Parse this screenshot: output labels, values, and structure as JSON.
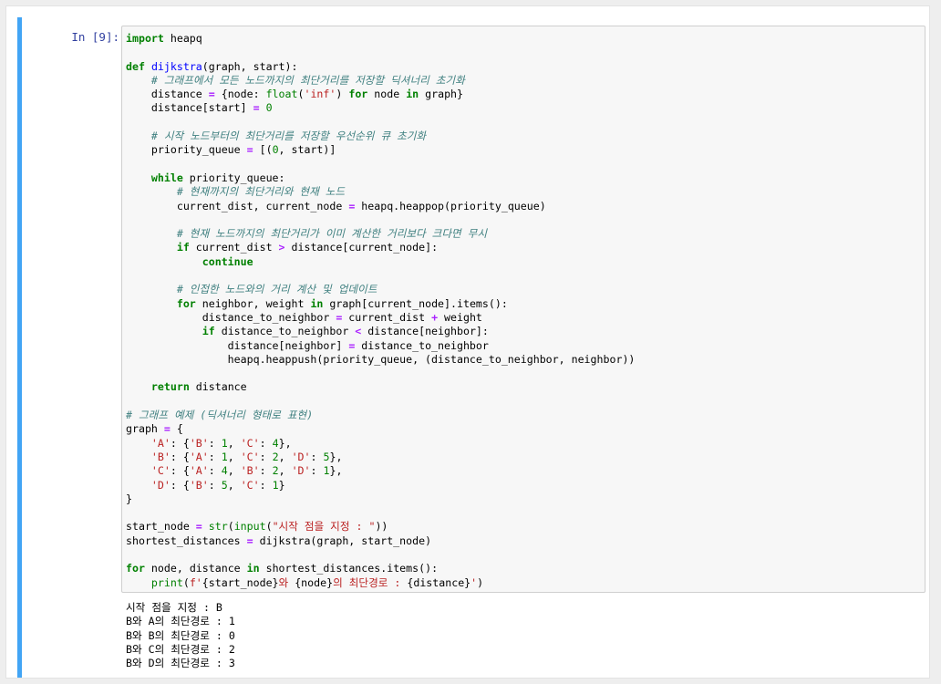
{
  "cell": {
    "prompt": "In [9]:",
    "code_lines": [
      [
        [
          "kw",
          "import"
        ],
        [
          "t",
          " heapq"
        ]
      ],
      [],
      [
        [
          "kw",
          "def"
        ],
        [
          "t",
          " "
        ],
        [
          "fn",
          "dijkstra"
        ],
        [
          "t",
          "(graph, start):"
        ]
      ],
      [
        [
          "t",
          "    "
        ],
        [
          "cm",
          "# 그래프에서 모든 노드까지의 최단거리를 저장할 딕셔너리 초기화"
        ]
      ],
      [
        [
          "t",
          "    distance "
        ],
        [
          "op",
          "="
        ],
        [
          "t",
          " {node: "
        ],
        [
          "bi",
          "float"
        ],
        [
          "t",
          "("
        ],
        [
          "st",
          "'inf'"
        ],
        [
          "t",
          ") "
        ],
        [
          "kw",
          "for"
        ],
        [
          "t",
          " node "
        ],
        [
          "kw",
          "in"
        ],
        [
          "t",
          " graph}"
        ]
      ],
      [
        [
          "t",
          "    distance[start] "
        ],
        [
          "op",
          "="
        ],
        [
          "t",
          " "
        ],
        [
          "nu",
          "0"
        ]
      ],
      [],
      [
        [
          "t",
          "    "
        ],
        [
          "cm",
          "# 시작 노드부터의 최단거리를 저장할 우선순위 큐 초기화"
        ]
      ],
      [
        [
          "t",
          "    priority_queue "
        ],
        [
          "op",
          "="
        ],
        [
          "t",
          " [("
        ],
        [
          "nu",
          "0"
        ],
        [
          "t",
          ", start)]"
        ]
      ],
      [],
      [
        [
          "t",
          "    "
        ],
        [
          "kw",
          "while"
        ],
        [
          "t",
          " priority_queue:"
        ]
      ],
      [
        [
          "t",
          "        "
        ],
        [
          "cm",
          "# 현재까지의 최단거리와 현재 노드"
        ]
      ],
      [
        [
          "t",
          "        current_dist, current_node "
        ],
        [
          "op",
          "="
        ],
        [
          "t",
          " heapq.heappop(priority_queue)"
        ]
      ],
      [],
      [
        [
          "t",
          "        "
        ],
        [
          "cm",
          "# 현재 노드까지의 최단거리가 이미 계산한 거리보다 크다면 무시"
        ]
      ],
      [
        [
          "t",
          "        "
        ],
        [
          "kw",
          "if"
        ],
        [
          "t",
          " current_dist "
        ],
        [
          "op",
          ">"
        ],
        [
          "t",
          " distance[current_node]:"
        ]
      ],
      [
        [
          "t",
          "            "
        ],
        [
          "kw",
          "continue"
        ]
      ],
      [],
      [
        [
          "t",
          "        "
        ],
        [
          "cm",
          "# 인접한 노드와의 거리 계산 및 업데이트"
        ]
      ],
      [
        [
          "t",
          "        "
        ],
        [
          "kw",
          "for"
        ],
        [
          "t",
          " neighbor, weight "
        ],
        [
          "kw",
          "in"
        ],
        [
          "t",
          " graph[current_node].items():"
        ]
      ],
      [
        [
          "t",
          "            distance_to_neighbor "
        ],
        [
          "op",
          "="
        ],
        [
          "t",
          " current_dist "
        ],
        [
          "op",
          "+"
        ],
        [
          "t",
          " weight"
        ]
      ],
      [
        [
          "t",
          "            "
        ],
        [
          "kw",
          "if"
        ],
        [
          "t",
          " distance_to_neighbor "
        ],
        [
          "op",
          "<"
        ],
        [
          "t",
          " distance[neighbor]:"
        ]
      ],
      [
        [
          "t",
          "                distance[neighbor] "
        ],
        [
          "op",
          "="
        ],
        [
          "t",
          " distance_to_neighbor"
        ]
      ],
      [
        [
          "t",
          "                heapq.heappush(priority_queue, (distance_to_neighbor, neighbor))"
        ]
      ],
      [],
      [
        [
          "t",
          "    "
        ],
        [
          "kw",
          "return"
        ],
        [
          "t",
          " distance"
        ]
      ],
      [],
      [
        [
          "cm",
          "# 그래프 예제 (딕셔너리 형태로 표현)"
        ]
      ],
      [
        [
          "t",
          "graph "
        ],
        [
          "op",
          "="
        ],
        [
          "t",
          " {"
        ]
      ],
      [
        [
          "t",
          "    "
        ],
        [
          "st",
          "'A'"
        ],
        [
          "t",
          ": {"
        ],
        [
          "st",
          "'B'"
        ],
        [
          "t",
          ": "
        ],
        [
          "nu",
          "1"
        ],
        [
          "t",
          ", "
        ],
        [
          "st",
          "'C'"
        ],
        [
          "t",
          ": "
        ],
        [
          "nu",
          "4"
        ],
        [
          "t",
          "},"
        ]
      ],
      [
        [
          "t",
          "    "
        ],
        [
          "st",
          "'B'"
        ],
        [
          "t",
          ": {"
        ],
        [
          "st",
          "'A'"
        ],
        [
          "t",
          ": "
        ],
        [
          "nu",
          "1"
        ],
        [
          "t",
          ", "
        ],
        [
          "st",
          "'C'"
        ],
        [
          "t",
          ": "
        ],
        [
          "nu",
          "2"
        ],
        [
          "t",
          ", "
        ],
        [
          "st",
          "'D'"
        ],
        [
          "t",
          ": "
        ],
        [
          "nu",
          "5"
        ],
        [
          "t",
          "},"
        ]
      ],
      [
        [
          "t",
          "    "
        ],
        [
          "st",
          "'C'"
        ],
        [
          "t",
          ": {"
        ],
        [
          "st",
          "'A'"
        ],
        [
          "t",
          ": "
        ],
        [
          "nu",
          "4"
        ],
        [
          "t",
          ", "
        ],
        [
          "st",
          "'B'"
        ],
        [
          "t",
          ": "
        ],
        [
          "nu",
          "2"
        ],
        [
          "t",
          ", "
        ],
        [
          "st",
          "'D'"
        ],
        [
          "t",
          ": "
        ],
        [
          "nu",
          "1"
        ],
        [
          "t",
          "},"
        ]
      ],
      [
        [
          "t",
          "    "
        ],
        [
          "st",
          "'D'"
        ],
        [
          "t",
          ": {"
        ],
        [
          "st",
          "'B'"
        ],
        [
          "t",
          ": "
        ],
        [
          "nu",
          "5"
        ],
        [
          "t",
          ", "
        ],
        [
          "st",
          "'C'"
        ],
        [
          "t",
          ": "
        ],
        [
          "nu",
          "1"
        ],
        [
          "t",
          "}"
        ]
      ],
      [
        [
          "t",
          "}"
        ]
      ],
      [],
      [
        [
          "t",
          "start_node "
        ],
        [
          "op",
          "="
        ],
        [
          "t",
          " "
        ],
        [
          "bi",
          "str"
        ],
        [
          "t",
          "("
        ],
        [
          "bi",
          "input"
        ],
        [
          "t",
          "("
        ],
        [
          "st",
          "\"시작 점을 지정 : \""
        ],
        [
          "t",
          "))"
        ]
      ],
      [
        [
          "t",
          "shortest_distances "
        ],
        [
          "op",
          "="
        ],
        [
          "t",
          " dijkstra(graph, start_node)"
        ]
      ],
      [],
      [
        [
          "kw",
          "for"
        ],
        [
          "t",
          " node, distance "
        ],
        [
          "kw",
          "in"
        ],
        [
          "t",
          " shortest_distances.items():"
        ]
      ],
      [
        [
          "t",
          "    "
        ],
        [
          "bi",
          "print"
        ],
        [
          "t",
          "("
        ],
        [
          "st",
          "f'"
        ],
        [
          "t",
          "{start_node}"
        ],
        [
          "st",
          "와 "
        ],
        [
          "t",
          "{node}"
        ],
        [
          "st",
          "의 최단경로 : "
        ],
        [
          "t",
          "{distance}"
        ],
        [
          "st",
          "'"
        ],
        [
          "t",
          ")"
        ]
      ]
    ],
    "output_lines": [
      "시작 점을 지정 : B",
      "B와 A의 최단경로 : 1",
      "B와 B의 최단경로 : 0",
      "B와 C의 최단경로 : 2",
      "B와 D의 최단경로 : 3"
    ]
  }
}
